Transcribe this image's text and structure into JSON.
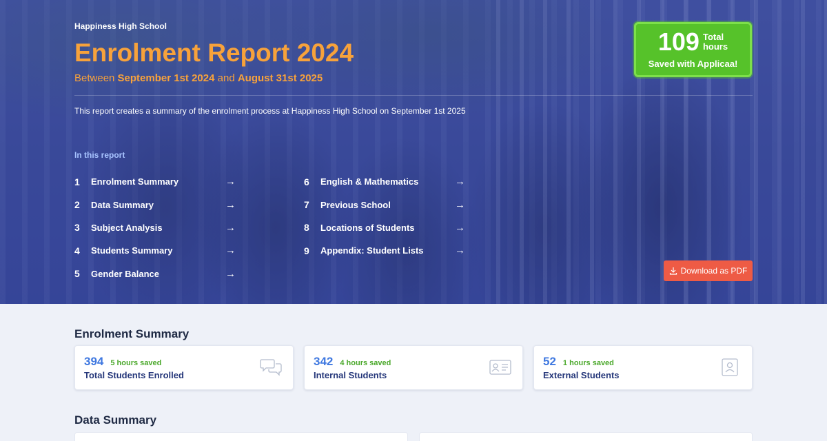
{
  "hero": {
    "school_name": "Happiness High School",
    "title": "Enrolment Report 2024",
    "subtitle": {
      "prefix": "Between ",
      "start": "September 1st 2024",
      "middle": " and ",
      "end": "August 31st 2025"
    },
    "description": "This report creates a summary of the enrolment process at Happiness High School on September 1st 2025",
    "toc_heading": "In this report",
    "toc_col1": [
      {
        "num": "1",
        "label": "Enrolment Summary",
        "arrow": "→"
      },
      {
        "num": "2",
        "label": "Data Summary",
        "arrow": "→"
      },
      {
        "num": "3",
        "label": "Subject Analysis",
        "arrow": "→"
      },
      {
        "num": "4",
        "label": "Students Summary",
        "arrow": "→"
      },
      {
        "num": "5",
        "label": "Gender Balance",
        "arrow": "→"
      }
    ],
    "toc_col2": [
      {
        "num": "6",
        "label": "English & Mathematics",
        "arrow": "→"
      },
      {
        "num": "7",
        "label": "Previous School",
        "arrow": "→"
      },
      {
        "num": "8",
        "label": "Locations of Students",
        "arrow": "→"
      },
      {
        "num": "9",
        "label": "Appendix: Student Lists",
        "arrow": "→"
      }
    ],
    "saved_badge": {
      "number": "109",
      "unit_line1": "Total",
      "unit_line2": "hours",
      "note": "Saved with Applicaa!"
    },
    "download_button": {
      "label": "Download as PDF",
      "icon": "download-icon"
    }
  },
  "enrolment_summary": {
    "heading": "Enrolment Summary",
    "cards": [
      {
        "value": "394",
        "saved": "5 hours saved",
        "label": "Total Students Enrolled",
        "icon": "chat-bubbles-icon"
      },
      {
        "value": "342",
        "saved": "4 hours saved",
        "label": "Internal Students",
        "icon": "id-card-icon"
      },
      {
        "value": "52",
        "saved": "1 hours saved",
        "label": "External Students",
        "icon": "user-badge-icon"
      }
    ]
  },
  "data_summary": {
    "heading": "Data Summary"
  },
  "colors": {
    "hero_bg": "#3a4aa0",
    "accent_orange": "#f7a23b",
    "badge_green": "#56c22a",
    "button_red": "#ee5b45",
    "stat_blue": "#3f78e0",
    "saved_green": "#4aa82a",
    "page_bg": "#eef1f8"
  }
}
